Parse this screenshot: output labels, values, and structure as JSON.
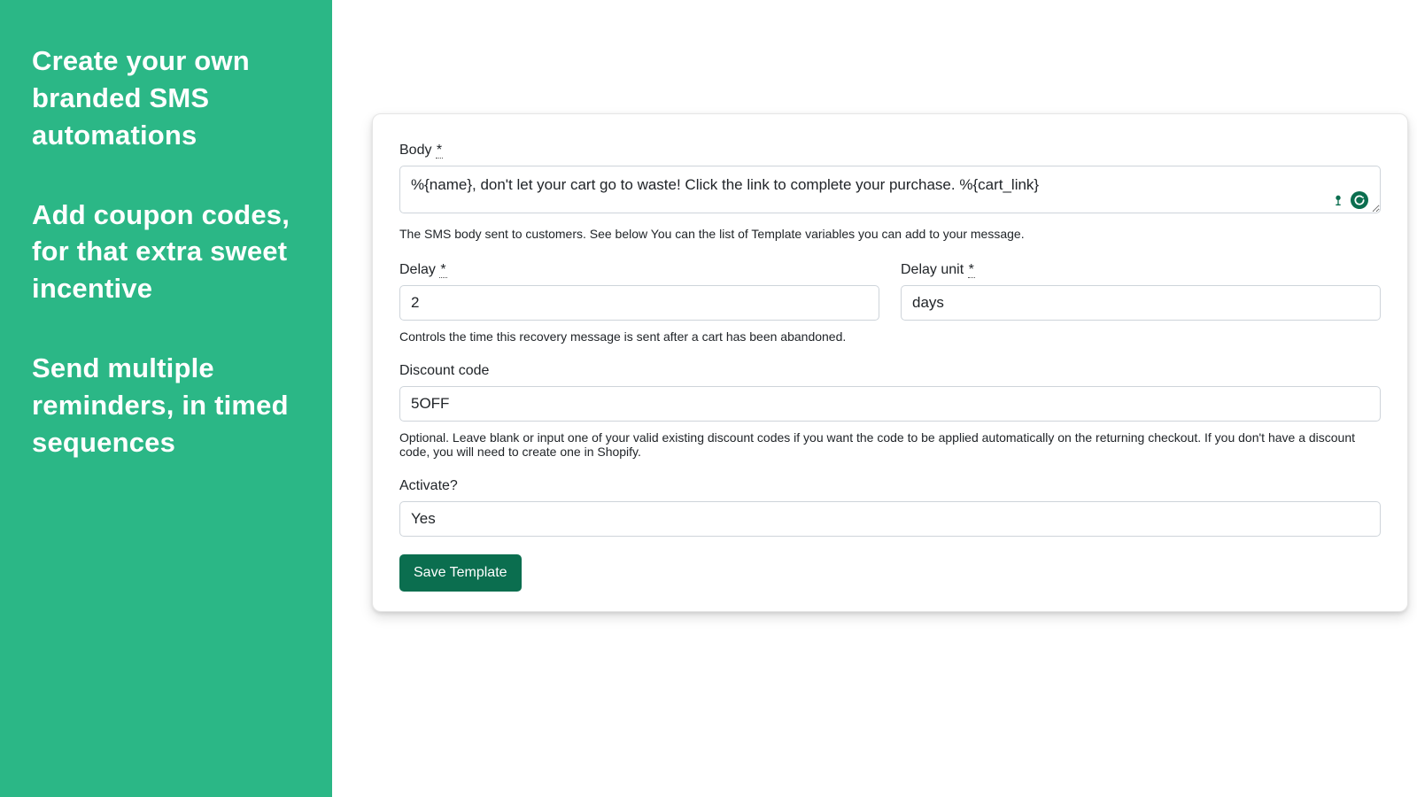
{
  "promo": {
    "p1": "Create your own branded SMS automations",
    "p2": "Add coupon codes, for that extra sweet incentive",
    "p3": "Send multiple reminders, in timed sequences"
  },
  "form": {
    "body_label": "Body",
    "required_mark": "*",
    "body_value": "%{name}, don't let your cart go to waste! Click the link to complete your purchase. %{cart_link}",
    "body_help": "The SMS body sent to customers. See below You can the list of Template variables you can add to your message.",
    "delay_label": "Delay",
    "delay_value": "2",
    "delay_unit_label": "Delay unit",
    "delay_unit_value": "days",
    "delay_help": "Controls the time this recovery message is sent after a cart has been abandoned.",
    "discount_label": "Discount code",
    "discount_value": "5OFF",
    "discount_help": "Optional. Leave blank or input one of your valid existing discount codes if you want the code to be applied automatically on the returning checkout. If you don't have a discount code, you will need to create one in Shopify.",
    "activate_label": "Activate?",
    "activate_value": "Yes",
    "save_label": "Save Template"
  }
}
